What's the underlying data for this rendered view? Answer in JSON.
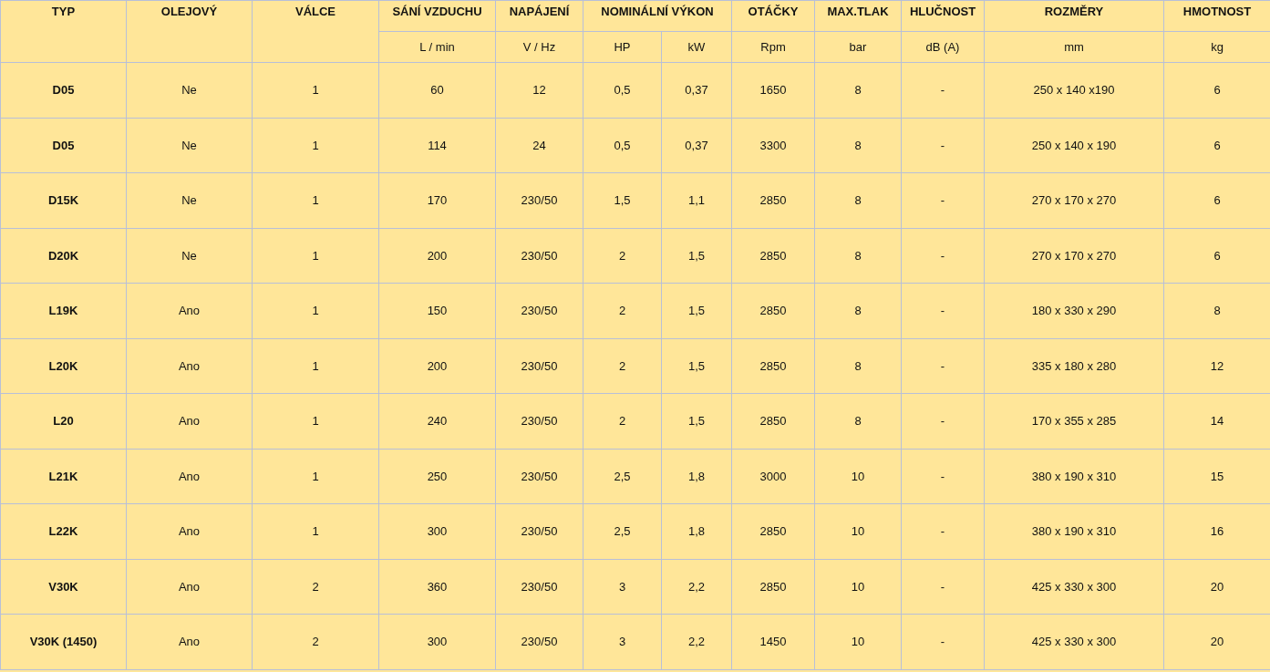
{
  "table": {
    "columns": [
      {
        "label": "TYP"
      },
      {
        "label": "OLEJOVÝ"
      },
      {
        "label": "VÁLCE"
      },
      {
        "label": "SÁNÍ VZDUCHU",
        "units": [
          "L / min"
        ]
      },
      {
        "label": "NAPÁJENÍ",
        "units": [
          "V / Hz"
        ]
      },
      {
        "label": "NOMINÁLNÍ VÝKON",
        "colspan": 2,
        "units": [
          "HP",
          "kW"
        ]
      },
      {
        "label": "OTÁČKY",
        "units": [
          "Rpm"
        ]
      },
      {
        "label": "MAX.TLAK",
        "units": [
          "bar"
        ]
      },
      {
        "label": "HLUČNOST",
        "units": [
          "dB (A)"
        ]
      },
      {
        "label": "ROZMĚRY",
        "units": [
          "mm"
        ]
      },
      {
        "label": "HMOTNOST",
        "units": [
          "kg"
        ]
      }
    ],
    "rows": [
      [
        "D05",
        "Ne",
        "1",
        "60",
        "12",
        "0,5",
        "0,37",
        "1650",
        "8",
        "-",
        "250 x 140 x190",
        "6"
      ],
      [
        "D05",
        "Ne",
        "1",
        "114",
        "24",
        "0,5",
        "0,37",
        "3300",
        "8",
        "-",
        "250 x 140 x 190",
        "6"
      ],
      [
        "D15K",
        "Ne",
        "1",
        "170",
        "230/50",
        "1,5",
        "1,1",
        "2850",
        "8",
        "-",
        "270 x 170 x 270",
        "6"
      ],
      [
        "D20K",
        "Ne",
        "1",
        "200",
        "230/50",
        "2",
        "1,5",
        "2850",
        "8",
        "-",
        "270 x 170 x 270",
        "6"
      ],
      [
        "L19K",
        "Ano",
        "1",
        "150",
        "230/50",
        "2",
        "1,5",
        "2850",
        "8",
        "-",
        "180 x 330 x 290",
        "8"
      ],
      [
        "L20K",
        "Ano",
        "1",
        "200",
        "230/50",
        "2",
        "1,5",
        "2850",
        "8",
        "-",
        "335 x 180 x 280",
        "12"
      ],
      [
        "L20",
        "Ano",
        "1",
        "240",
        "230/50",
        "2",
        "1,5",
        "2850",
        "8",
        "-",
        "170 x 355 x 285",
        "14"
      ],
      [
        "L21K",
        "Ano",
        "1",
        "250",
        "230/50",
        "2,5",
        "1,8",
        "3000",
        "10",
        "-",
        "380 x 190 x 310",
        "15"
      ],
      [
        "L22K",
        "Ano",
        "1",
        "300",
        "230/50",
        "2,5",
        "1,8",
        "2850",
        "10",
        "-",
        "380 x 190 x 310",
        "16"
      ],
      [
        "V30K",
        "Ano",
        "2",
        "360",
        "230/50",
        "3",
        "2,2",
        "2850",
        "10",
        "-",
        "425 x 330 x 300",
        "20"
      ],
      [
        "V30K (1450)",
        "Ano",
        "2",
        "300",
        "230/50",
        "3",
        "2,2",
        "1450",
        "10",
        "-",
        "425 x 330 x 300",
        "20"
      ]
    ]
  }
}
